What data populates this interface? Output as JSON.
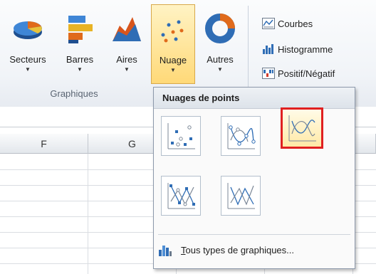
{
  "ribbon": {
    "chart_buttons": [
      {
        "id": "secteurs",
        "label": "Secteurs",
        "icon": "pie-chart-icon"
      },
      {
        "id": "barres",
        "label": "Barres",
        "icon": "bar-chart-icon"
      },
      {
        "id": "aires",
        "label": "Aires",
        "icon": "area-chart-icon"
      },
      {
        "id": "nuage",
        "label": "Nuage",
        "icon": "scatter-chart-icon",
        "active": true
      },
      {
        "id": "autres",
        "label": "Autres",
        "icon": "donut-chart-icon"
      }
    ],
    "group_label": "Graphiques",
    "sparklines": [
      {
        "label": "Courbes",
        "icon": "line-sparkline-icon"
      },
      {
        "label": "Histogramme",
        "icon": "column-sparkline-icon"
      },
      {
        "label": "Positif/Négatif",
        "icon": "win-loss-sparkline-icon"
      }
    ]
  },
  "sheet": {
    "columns": [
      "F",
      "G"
    ]
  },
  "dropdown": {
    "header": "Nuages de points",
    "options": [
      {
        "name": "Nuage avec marqueurs uniquement",
        "icon": "scatter-markers-icon"
      },
      {
        "name": "Nuage avec lignes lissées et marqueurs",
        "icon": "scatter-smooth-markers-icon"
      },
      {
        "name": "Nuage avec lignes lissées",
        "icon": "scatter-smooth-lines-icon",
        "selected": true
      },
      {
        "name": "Nuage avec lignes droites et marqueurs",
        "icon": "scatter-straight-markers-icon"
      },
      {
        "name": "Nuage avec lignes droites",
        "icon": "scatter-straight-lines-icon"
      }
    ],
    "footer": {
      "prefix": "T",
      "rest": "ous types de graphiques...",
      "icon": "all-chart-types-icon"
    }
  },
  "colors": {
    "active_fill": "#ffd978",
    "selected_border": "#e02020",
    "accent_blue": "#2f6db5"
  }
}
